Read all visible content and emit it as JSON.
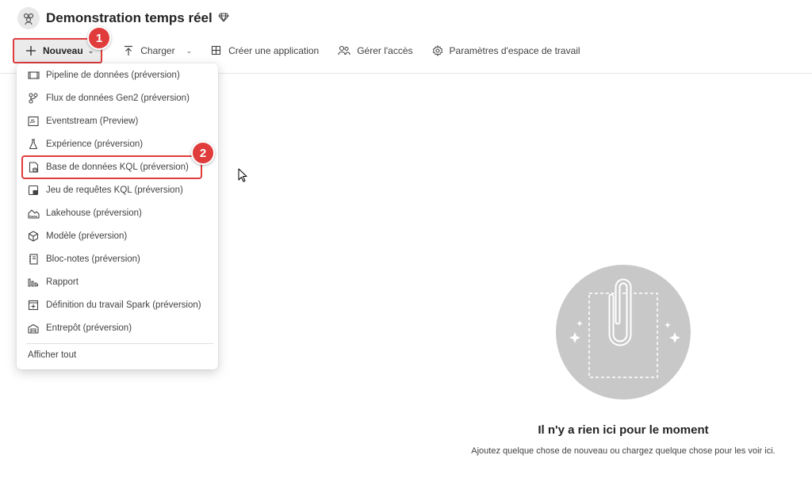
{
  "workspace": {
    "title": "Demonstration temps réel",
    "icon": "workspace-people-icon",
    "premium_icon": "diamond-icon"
  },
  "toolbar": {
    "new_label": "Nouveau",
    "upload_label": "Charger",
    "create_app_label": "Créer une application",
    "manage_access_label": "Gérer l'accès",
    "workspace_settings_label": "Paramètres d'espace de travail"
  },
  "badges": {
    "first": "1",
    "second": "2"
  },
  "menu": {
    "items": [
      {
        "label": "Pipeline de données (préversion)",
        "icon": "pipeline-icon"
      },
      {
        "label": "Flux de données Gen2 (préversion)",
        "icon": "dataflow-icon"
      },
      {
        "label": "Eventstream (Preview)",
        "icon": "eventstream-icon"
      },
      {
        "label": "Expérience (préversion)",
        "icon": "flask-icon"
      },
      {
        "label": "Base de données KQL (préversion)",
        "icon": "kql-database-icon"
      },
      {
        "label": "Jeu de requêtes KQL (préversion)",
        "icon": "kql-queryset-icon"
      },
      {
        "label": "Lakehouse (préversion)",
        "icon": "lakehouse-icon"
      },
      {
        "label": "Modèle (préversion)",
        "icon": "model-cube-icon"
      },
      {
        "label": "Bloc-notes (préversion)",
        "icon": "notebook-icon"
      },
      {
        "label": "Rapport",
        "icon": "report-icon"
      },
      {
        "label": "Définition du travail Spark (préversion)",
        "icon": "spark-job-icon"
      },
      {
        "label": "Entrepôt (préversion)",
        "icon": "warehouse-icon"
      }
    ],
    "show_all": "Afficher tout"
  },
  "empty_state": {
    "title": "Il n'y a rien ici pour le moment",
    "subtitle": "Ajoutez quelque chose de nouveau ou chargez quelque chose pour les voir ici."
  },
  "colors": {
    "highlight": "#e03c3c",
    "empty_circle": "#c8c8c8"
  }
}
